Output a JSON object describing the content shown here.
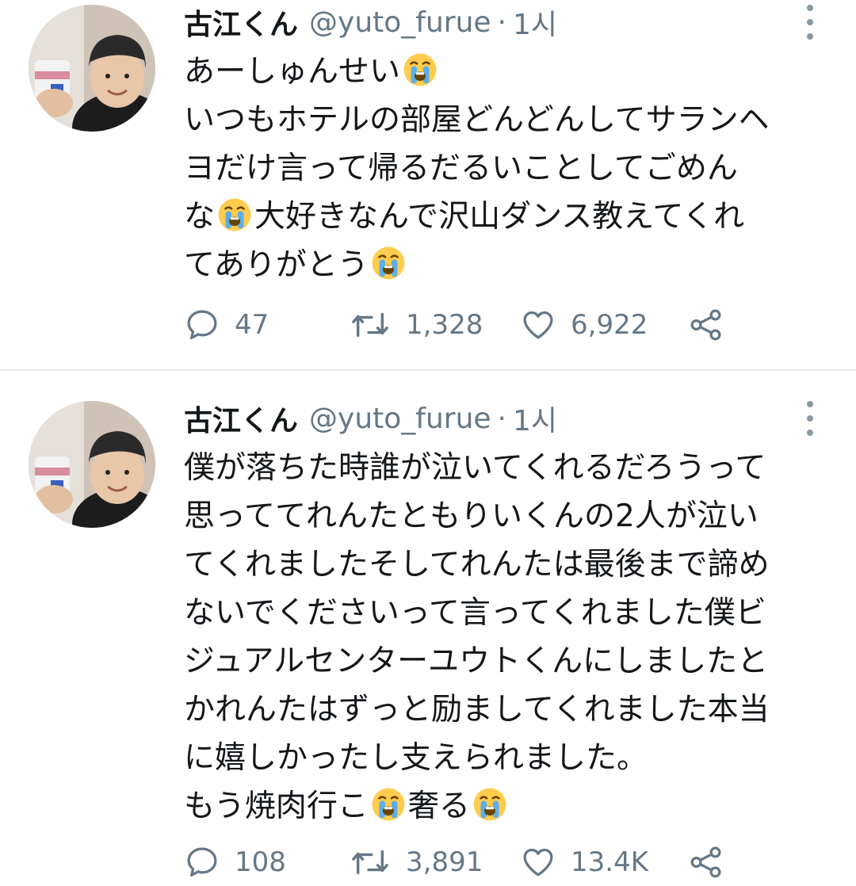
{
  "tweets": [
    {
      "display_name": "古江くん",
      "handle": "@yuto_furue",
      "separator": "·",
      "time": "1시",
      "lines": [
        [
          "あーしゅんせい",
          "{cry}"
        ],
        [
          "いつもホテルの部屋どんどんしてサランヘ"
        ],
        [
          "ヨだけ言って帰るだるいことしてごめん"
        ],
        [
          "な",
          "{cry}",
          "大好きなんで沢山ダンス教えてくれ"
        ],
        [
          "てありがとう",
          "{cry}"
        ]
      ],
      "stats": {
        "replies": "47",
        "retweets": "1,328",
        "likes": "6,922"
      }
    },
    {
      "display_name": "古江くん",
      "handle": "@yuto_furue",
      "separator": "·",
      "time": "1시",
      "lines": [
        [
          "僕が落ちた時誰が泣いてくれるだろうって"
        ],
        [
          "思っててれんたともりいくんの2人が泣い"
        ],
        [
          "てくれましたそしてれんたは最後まで諦め"
        ],
        [
          "ないでくださいって言ってくれました僕ビ"
        ],
        [
          "ジュアルセンターユウトくんにしましたと"
        ],
        [
          "かれんたはずっと励ましてくれました本当"
        ],
        [
          "に嬉しかったし支えられました。"
        ],
        [
          "もう焼肉行こ",
          "{cry}",
          "奢る",
          "{cry}"
        ]
      ],
      "stats": {
        "replies": "108",
        "retweets": "3,891",
        "likes": "13.4K"
      }
    }
  ],
  "icons": {
    "reply": "reply-icon",
    "retweet": "retweet-icon",
    "like": "heart-icon",
    "share": "share-icon",
    "more": "more-vertical-icon",
    "emoji": "loudly-crying-face-emoji"
  },
  "colors": {
    "text": "#14171a",
    "secondary": "#657786",
    "divider": "#e1e8ed"
  }
}
